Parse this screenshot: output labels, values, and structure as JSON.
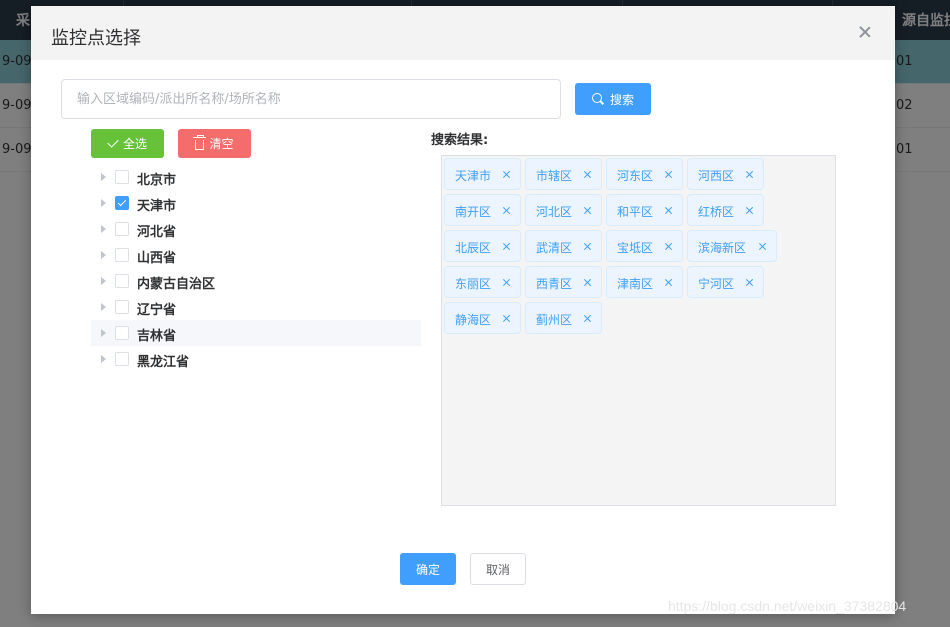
{
  "background": {
    "header_left": "采",
    "header_right": "源自监拉",
    "rows": [
      {
        "left": "9-09",
        "right": "01"
      },
      {
        "left": "9-09",
        "right": "02"
      },
      {
        "left": "9-09",
        "right": "01"
      }
    ]
  },
  "dialog": {
    "title": "监控点选择",
    "search_placeholder": "输入区域编码/派出所名称/场所名称",
    "search_button": "搜索",
    "select_all_button": "全选",
    "clear_button": "清空",
    "results_title": "搜索结果:",
    "confirm_button": "确定",
    "cancel_button": "取消"
  },
  "tree": [
    {
      "label": "北京市",
      "checked": false
    },
    {
      "label": "天津市",
      "checked": true
    },
    {
      "label": "河北省",
      "checked": false
    },
    {
      "label": "山西省",
      "checked": false
    },
    {
      "label": "内蒙古自治区",
      "checked": false
    },
    {
      "label": "辽宁省",
      "checked": false
    },
    {
      "label": "吉林省",
      "checked": false
    },
    {
      "label": "黑龙江省",
      "checked": false
    }
  ],
  "tags": [
    [
      "天津市",
      "市辖区",
      "河东区",
      "河西区"
    ],
    [
      "南开区",
      "河北区",
      "和平区",
      "红桥区"
    ],
    [
      "北辰区",
      "武清区",
      "宝坻区",
      "滨海新区"
    ],
    [
      "东丽区",
      "西青区",
      "津南区",
      "宁河区"
    ],
    [
      "静海区",
      "蓟州区"
    ]
  ],
  "watermark": "https://blog.csdn.net/weixin_37382804"
}
